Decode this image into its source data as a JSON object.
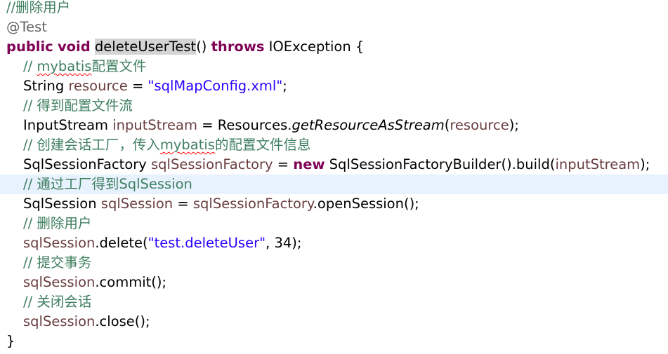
{
  "editor": {
    "comment_header": "//删除用户",
    "annotation": "@Test",
    "sig": {
      "kw_public": "public",
      "kw_void": "void",
      "method_name": "deleteUserTest",
      "parens": "() ",
      "kw_throws": "throws",
      "exception": " IOException {"
    },
    "l4": {
      "prefix": "// ",
      "mybatis": "mybatis",
      "suffix": "配置文件"
    },
    "l5": {
      "type": "String ",
      "var": "resource",
      "eq": " = ",
      "str": "\"sqlMapConfig.xml\"",
      "end": ";"
    },
    "l6": {
      "comment": "// 得到配置文件流"
    },
    "l7": {
      "type": "InputStream ",
      "var": "inputStream",
      "eq": " = Resources.",
      "method": "getResourceAsStream",
      "open": "(",
      "arg": "resource",
      "close": ");"
    },
    "l8": {
      "prefix": "// 创建会话工厂，传入",
      "mybatis": "mybatis",
      "suffix": "的配置文件信息"
    },
    "l9": {
      "type": "SqlSessionFactory ",
      "var": "sqlSessionFactory",
      "eq": " = ",
      "kw_new": "new",
      "builder": " SqlSessionFactoryBuilder().build(",
      "arg": "inputStream",
      "close": ");"
    },
    "l10": {
      "comment": "// 通过工厂得到SqlSession"
    },
    "l11": {
      "type": "SqlSession ",
      "var": "sqlSession",
      "eq": " = ",
      "obj": "sqlSessionFactory",
      "call": ".openSession();"
    },
    "l12": {
      "comment": "// 删除用户"
    },
    "l13": {
      "obj": "sqlSession",
      "call_open": ".delete(",
      "str": "\"test.deleteUser\"",
      "rest": ", 34);"
    },
    "l14": {
      "comment": "// 提交事务"
    },
    "l15": {
      "obj": "sqlSession",
      "call": ".commit();"
    },
    "l16": {
      "comment": "// 关闭会话"
    },
    "l17": {
      "obj": "sqlSession",
      "call": ".close();"
    },
    "closing_brace": "}"
  }
}
